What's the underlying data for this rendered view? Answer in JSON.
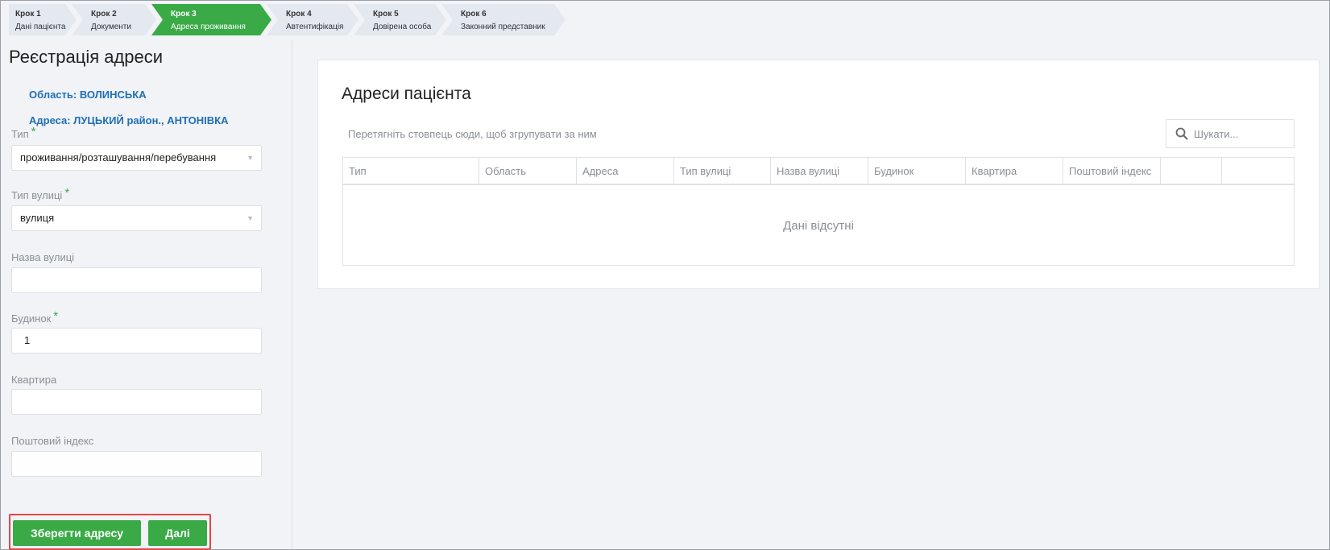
{
  "stepper": {
    "steps": [
      {
        "title": "Крок 1",
        "subtitle": "Дані пацієнта",
        "active": false
      },
      {
        "title": "Крок 2",
        "subtitle": "Документи",
        "active": false
      },
      {
        "title": "Крок 3",
        "subtitle": "Адреса проживання",
        "active": true
      },
      {
        "title": "Крок 4",
        "subtitle": "Автентифікація",
        "active": false
      },
      {
        "title": "Крок 5",
        "subtitle": "Довірена особа",
        "active": false
      },
      {
        "title": "Крок 6",
        "subtitle": "Законний представник",
        "active": false
      }
    ]
  },
  "form": {
    "title": "Реєстрація адреси",
    "region_line": "Область: ВОЛИНСЬКА",
    "address_line": "Адреса: ЛУЦЬКИЙ район., АНТОНІВКА",
    "type": {
      "label": "Тип",
      "required_mark": "*",
      "value": "проживання/розташування/перебування"
    },
    "street_type": {
      "label": "Тип вулиці",
      "required_mark": "*",
      "value": "вулиця"
    },
    "street_name": {
      "label": "Назва вулиці",
      "value": ""
    },
    "building": {
      "label": "Будинок",
      "required_mark": "*",
      "value": "1"
    },
    "apartment": {
      "label": "Квартира",
      "value": ""
    },
    "postal_code": {
      "label": "Поштовий індекс",
      "value": ""
    },
    "save_label": "Зберегти адресу",
    "next_label": "Далі"
  },
  "addresses": {
    "title": "Адреси пацієнта",
    "group_hint": "Перетягніть стовпець сюди, щоб згрупувати за ним",
    "search_placeholder": "Шукати...",
    "columns": [
      "Тип",
      "Область",
      "Адреса",
      "Тип вулиці",
      "Назва вулиці",
      "Будинок",
      "Квартира",
      "Поштовий індекс",
      ""
    ],
    "empty_text": "Дані відсутні"
  },
  "colors": {
    "accent_green": "#3aaa47",
    "link_blue": "#1f6fb5",
    "highlight_red": "#e04848"
  },
  "icons": {
    "search": "search-icon",
    "dropdown": "chevron-down-icon"
  }
}
